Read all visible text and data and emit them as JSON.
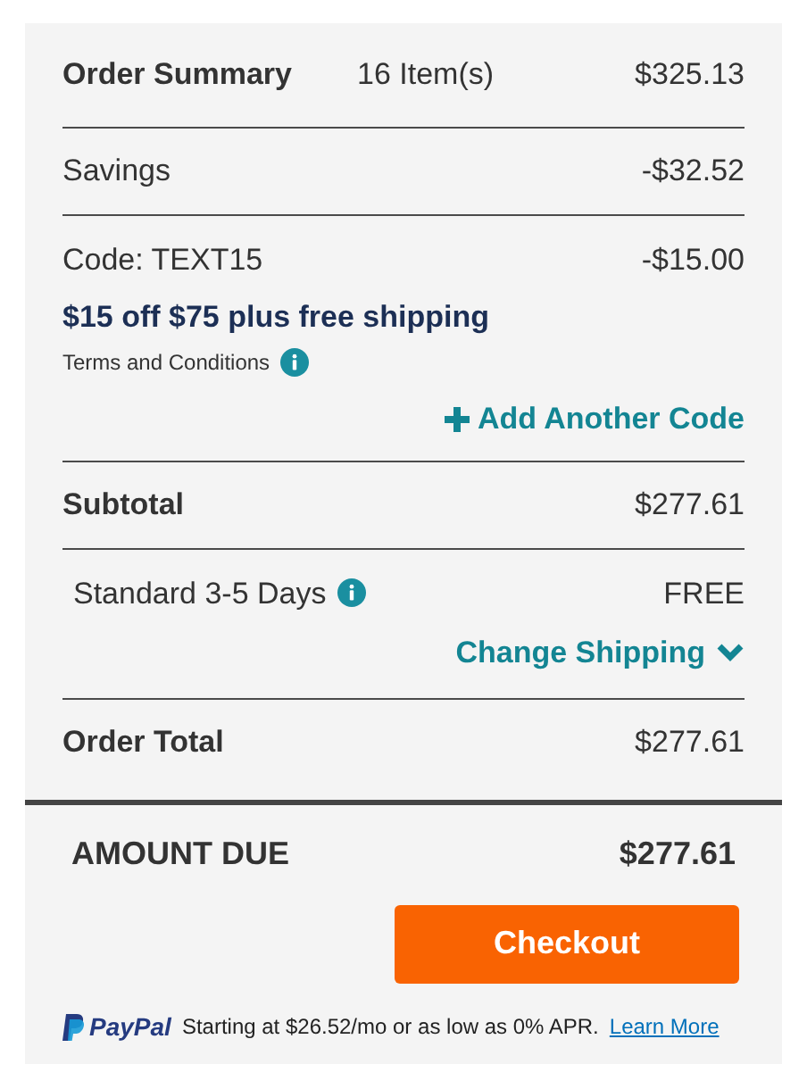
{
  "summary": {
    "title": "Order Summary",
    "item_count": "16 Item(s)",
    "amount": "$325.13"
  },
  "savings": {
    "label": "Savings",
    "amount": "-$32.52"
  },
  "promo": {
    "code_label": "Code: TEXT15",
    "amount": "-$15.00",
    "headline": "$15 off $75 plus free shipping",
    "terms": "Terms and Conditions",
    "add_code": "Add Another Code"
  },
  "subtotal": {
    "label": "Subtotal",
    "amount": "$277.61"
  },
  "shipping": {
    "label": "Standard 3-5 Days",
    "amount": "FREE",
    "change": "Change Shipping",
    "expanded": false
  },
  "order_total": {
    "label": "Order Total",
    "amount": "$277.61"
  },
  "amount_due": {
    "label": "AMOUNT DUE",
    "amount": "$277.61"
  },
  "checkout": {
    "label": "Checkout"
  },
  "paypal": {
    "brand": "PayPal",
    "message": "Starting at $26.52/mo or as low as 0% APR.",
    "link": "Learn More"
  }
}
